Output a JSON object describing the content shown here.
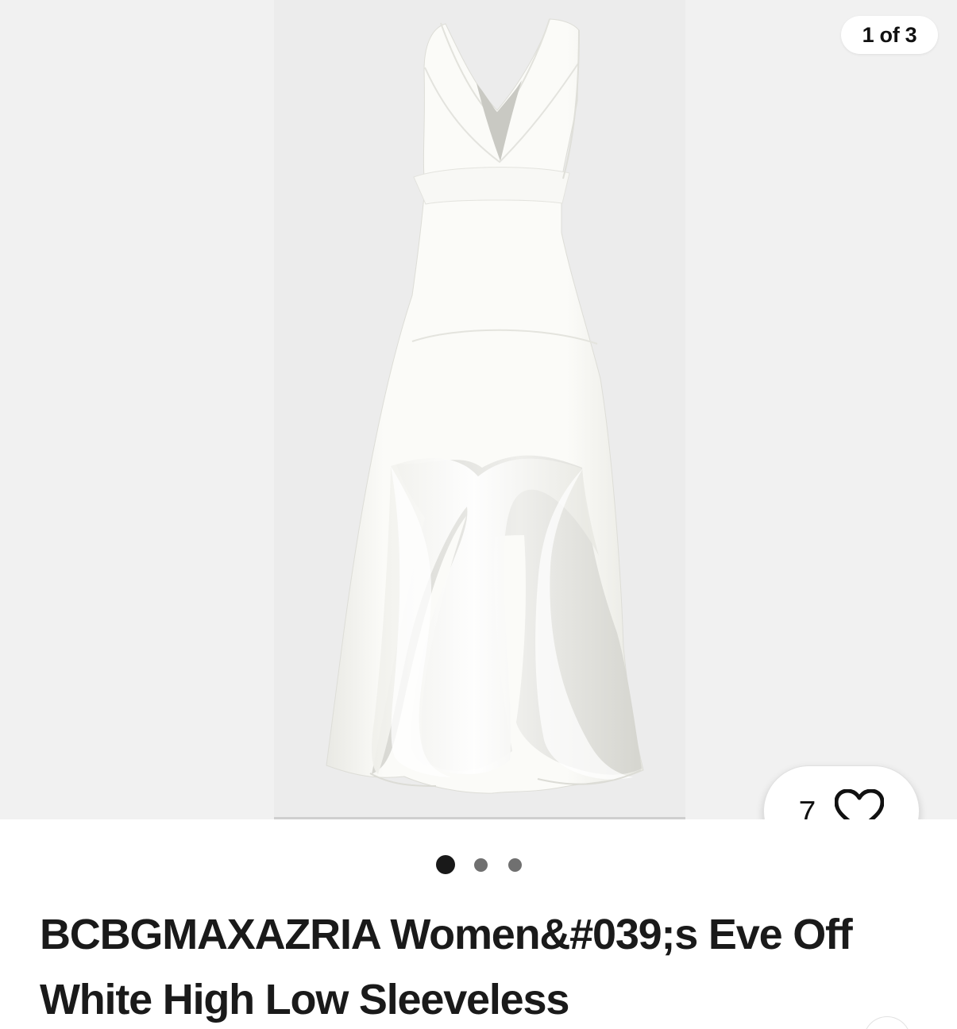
{
  "gallery": {
    "counter": "1 of 3",
    "image_alt": "Off white high low sleeveless dress"
  },
  "watch": {
    "count": "7",
    "icon": "heart-icon"
  },
  "carousel": {
    "active_dot": 1,
    "total_dots": 3
  },
  "product": {
    "title": "BCBGMAXAZRIA Women&#039;s Eve Off White High Low Sleeveless"
  },
  "colors": {
    "gallery_background": "#f1f1f1",
    "dress": "#fbfbf8",
    "text": "#1a1a1a"
  }
}
